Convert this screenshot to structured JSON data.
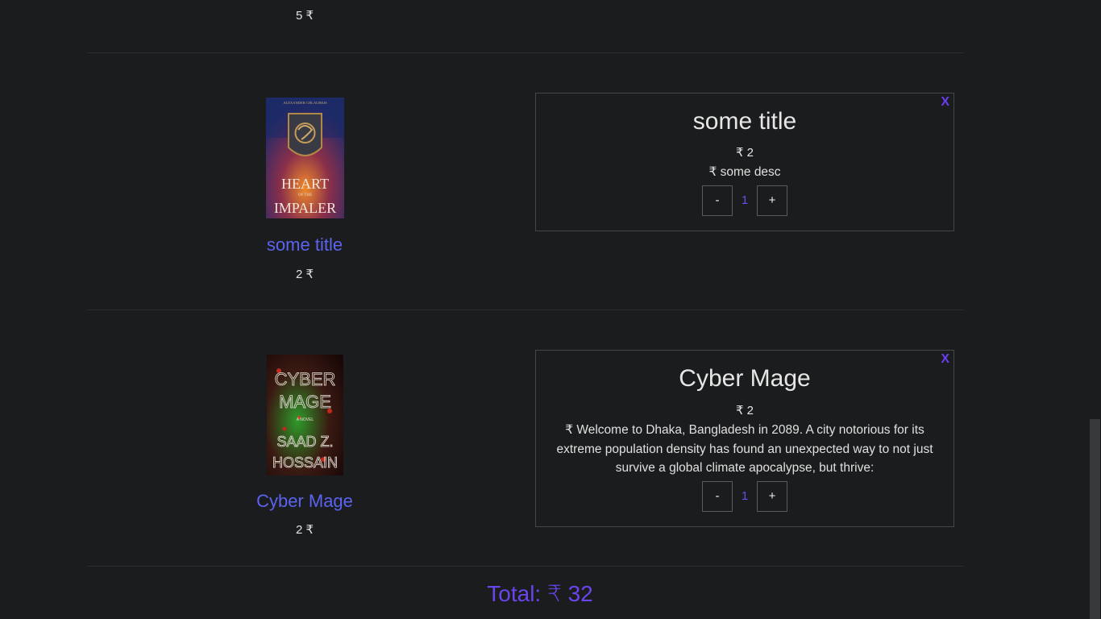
{
  "previous_item": {
    "price": "5 ₹"
  },
  "cart_items": [
    {
      "title": "some title",
      "price": "2 ₹",
      "cover": {
        "author_line": "ALEXANDER CHLAURKIS",
        "line1": "HEART",
        "line2": "OF THE",
        "line3": "IMPALER"
      },
      "card": {
        "close": "X",
        "title": "some title",
        "price": "₹ 2",
        "description": "₹ some desc",
        "minus": "-",
        "quantity": "1",
        "plus": "+"
      }
    },
    {
      "title": "Cyber Mage",
      "price": "2 ₹",
      "cover": {
        "line1": "CYBER",
        "line2": "MAGE",
        "subtitle": "A NOVEL",
        "author1": "SAAD Z.",
        "author2": "HOSSAIN"
      },
      "card": {
        "close": "X",
        "title": "Cyber Mage",
        "price": "₹ 2",
        "description": "₹ Welcome to Dhaka, Bangladesh in 2089. A city notorious for its extreme population density has found an unexpected way to not just survive a global climate apocalypse, but thrive:",
        "minus": "-",
        "quantity": "1",
        "plus": "+"
      }
    }
  ],
  "total": "Total: ₹ 32",
  "colors": {
    "background": "#1b1c1e",
    "link": "#5b63f0",
    "accent": "#6a45ec"
  }
}
